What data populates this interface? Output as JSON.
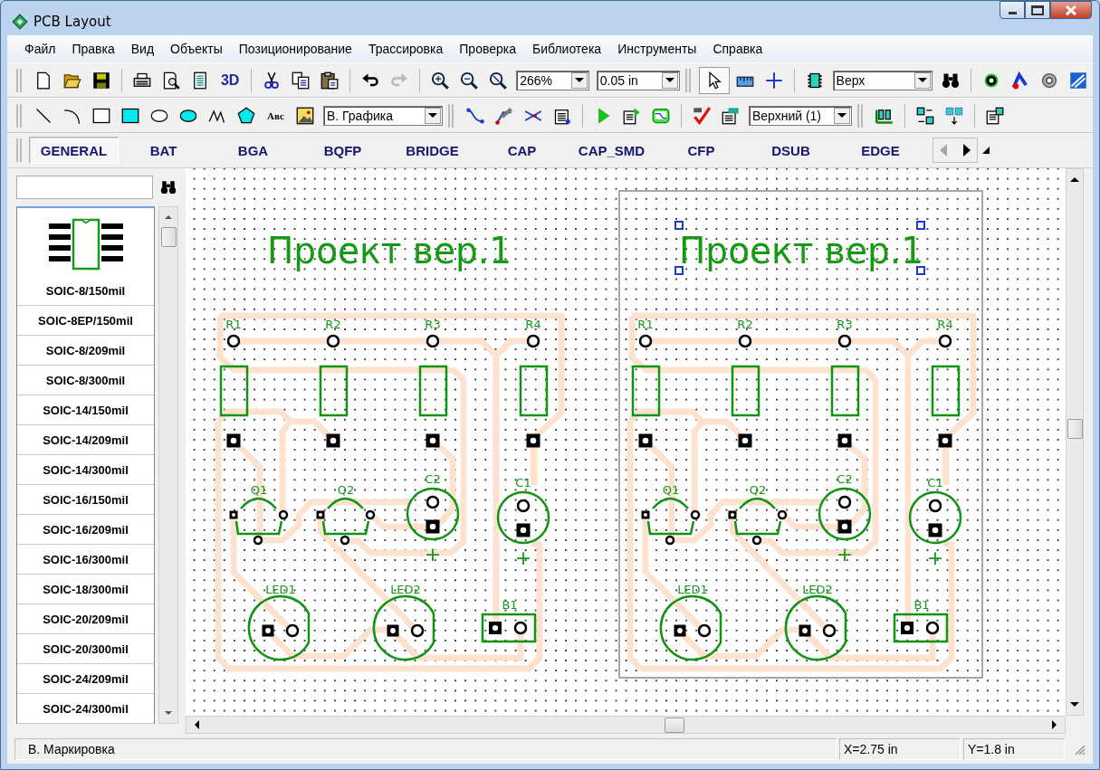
{
  "window": {
    "title": "PCB Layout"
  },
  "menu": [
    "Файл",
    "Правка",
    "Вид",
    "Объекты",
    "Позиционирование",
    "Трассировка",
    "Проверка",
    "Библиотека",
    "Инструменты",
    "Справка"
  ],
  "toolbar_main": {
    "view_3d": "3D",
    "redo": {
      "disabled": true
    },
    "zoom": "266%",
    "grid": "0.05 in",
    "pointer": {
      "selected": true
    },
    "layer": "Верх"
  },
  "toolbar_draw": {
    "text_tool": "Авс",
    "graphics_layer": "В. Графика",
    "copper_layer": "Верхний (1)"
  },
  "library_tabs": [
    {
      "label": "GENERAL",
      "selected": true
    },
    {
      "label": "BAT",
      "selected": false
    },
    {
      "label": "BGA",
      "selected": false
    },
    {
      "label": "BQFP",
      "selected": false
    },
    {
      "label": "BRIDGE",
      "selected": false
    },
    {
      "label": "CAP",
      "selected": false
    },
    {
      "label": "CAP_SMD",
      "selected": false
    },
    {
      "label": "CFP",
      "selected": false
    },
    {
      "label": "DSUB",
      "selected": false
    },
    {
      "label": "EDGE",
      "selected": false
    }
  ],
  "library_items": [
    "SOIC-8/150mil",
    "SOIC-8EP/150mil",
    "SOIC-8/209mil",
    "SOIC-8/300mil",
    "SOIC-14/150mil",
    "SOIC-14/209mil",
    "SOIC-14/300mil",
    "SOIC-16/150mil",
    "SOIC-16/209mil",
    "SOIC-16/300mil",
    "SOIC-18/300mil",
    "SOIC-20/209mil",
    "SOIC-20/300mil",
    "SOIC-24/209mil",
    "SOIC-24/300mil"
  ],
  "boards": [
    {
      "title": "Проект вер.1",
      "title_selected": false,
      "outline": false,
      "components": [
        {
          "kind": "resistor",
          "label": "R1"
        },
        {
          "kind": "resistor",
          "label": "R2"
        },
        {
          "kind": "resistor",
          "label": "R3"
        },
        {
          "kind": "resistor",
          "label": "R4"
        },
        {
          "kind": "transistor",
          "label": "Q1"
        },
        {
          "kind": "transistor",
          "label": "Q2"
        },
        {
          "kind": "capacitor",
          "label": "C2",
          "polarity": "+"
        },
        {
          "kind": "capacitor",
          "label": "C1",
          "polarity": "+"
        },
        {
          "kind": "led",
          "label": "LED1"
        },
        {
          "kind": "led",
          "label": "LED2"
        },
        {
          "kind": "battery",
          "label": "B1"
        }
      ]
    },
    {
      "title": "Проект вер.1",
      "title_selected": true,
      "outline": true,
      "components": [
        {
          "kind": "resistor",
          "label": "R1"
        },
        {
          "kind": "resistor",
          "label": "R2"
        },
        {
          "kind": "resistor",
          "label": "R3"
        },
        {
          "kind": "resistor",
          "label": "R4"
        },
        {
          "kind": "transistor",
          "label": "Q1"
        },
        {
          "kind": "transistor",
          "label": "Q2"
        },
        {
          "kind": "capacitor",
          "label": "C2",
          "polarity": "+"
        },
        {
          "kind": "capacitor",
          "label": "C1",
          "polarity": "+"
        },
        {
          "kind": "led",
          "label": "LED1"
        },
        {
          "kind": "led",
          "label": "LED2"
        },
        {
          "kind": "battery",
          "label": "B1"
        }
      ]
    }
  ],
  "status_bar": {
    "layer": "В. Маркировка",
    "x": "X=2.75 in",
    "y": "Y=1.8 in"
  }
}
